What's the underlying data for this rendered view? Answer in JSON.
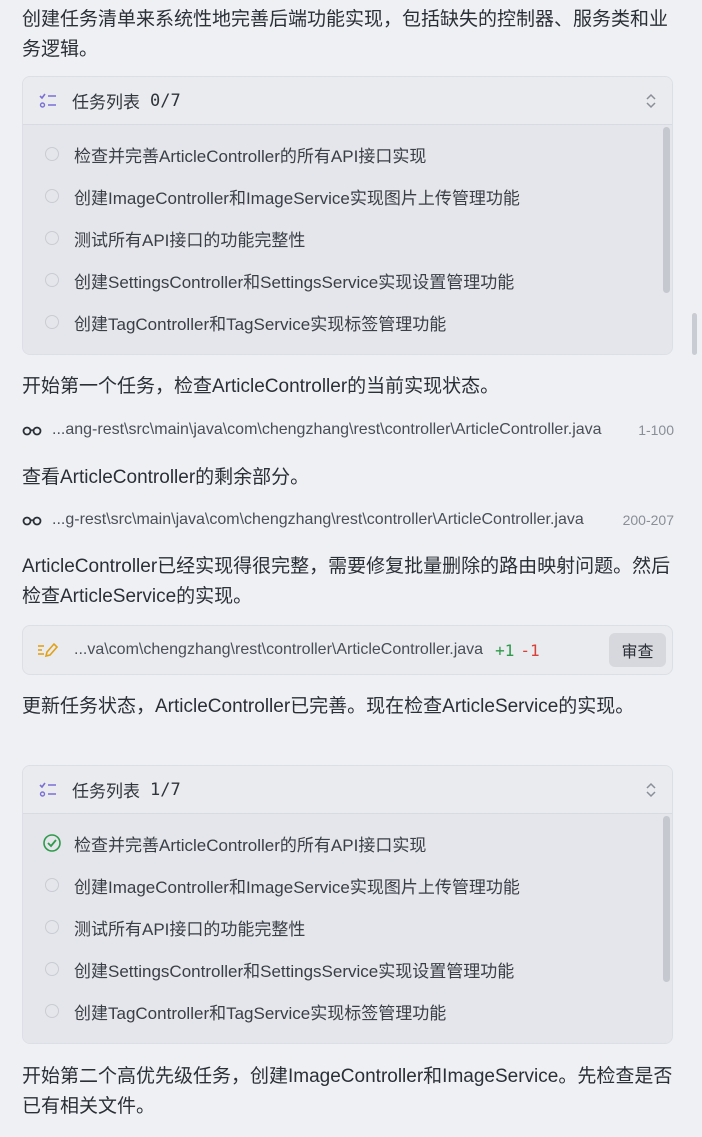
{
  "intro_text": "创建任务清单来系统性地完善后端功能实现，包括缺失的控制器、服务类和业务逻辑。",
  "task_list_1": {
    "title": "任务列表",
    "count": "0/7",
    "tasks": [
      "检查并完善ArticleController的所有API接口实现",
      "创建ImageController和ImageService实现图片上传管理功能",
      "测试所有API接口的功能完整性",
      "创建SettingsController和SettingsService实现设置管理功能",
      "创建TagController和TagService实现标签管理功能"
    ]
  },
  "para_start_first": "开始第一个任务，检查ArticleController的当前实现状态。",
  "file_read_1": {
    "path": "...ang-rest\\src\\main\\java\\com\\chengzhang\\rest\\controller\\ArticleController.java",
    "range": "1-100"
  },
  "para_view_rest": "查看ArticleController的剩余部分。",
  "file_read_2": {
    "path": "...g-rest\\src\\main\\java\\com\\chengzhang\\rest\\controller\\ArticleController.java",
    "range": "200-207"
  },
  "para_controller_done": "ArticleController已经实现得很完整，需要修复批量删除的路由映射问题。然后检查ArticleService的实现。",
  "edit": {
    "path": "...va\\com\\chengzhang\\rest\\controller\\ArticleController.java",
    "added": "+1",
    "removed": "-1",
    "review_label": "审查"
  },
  "para_update_status": "更新任务状态，ArticleController已完善。现在检查ArticleService的实现。",
  "task_list_2": {
    "title": "任务列表",
    "count": "1/7",
    "tasks": [
      "检查并完善ArticleController的所有API接口实现",
      "创建ImageController和ImageService实现图片上传管理功能",
      "测试所有API接口的功能完整性",
      "创建SettingsController和SettingsService实现设置管理功能",
      "创建TagController和TagService实现标签管理功能"
    ]
  },
  "para_start_second": "开始第二个高优先级任务，创建ImageController和ImageService。先检查是否已有相关文件。",
  "colors": {
    "done_green": "#2e9a4a",
    "removed_red": "#d9403a",
    "list_icon": "#7b6fd6",
    "edit_icon": "#e0a21a"
  }
}
